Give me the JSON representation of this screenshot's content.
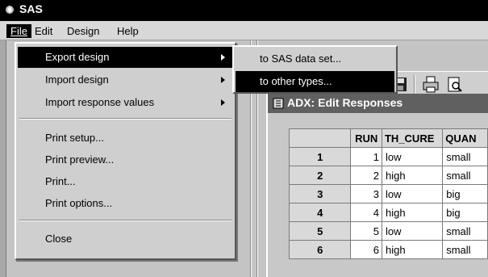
{
  "app": {
    "title": "SAS"
  },
  "menubar": {
    "items": [
      "File",
      "Edit",
      "Design",
      "Help"
    ]
  },
  "file_menu": {
    "export_design": "Export design",
    "import_design": "Import design",
    "import_response_values": "Import response values",
    "print_setup": "Print setup...",
    "print_preview": "Print preview...",
    "print": "Print...",
    "print_options": "Print options...",
    "close": "Close"
  },
  "export_submenu": {
    "to_sas_data_set": "to SAS data set...",
    "to_other_types": "to other types..."
  },
  "toolbar": {
    "icons": [
      "save-icon",
      "print-icon",
      "print-preview-icon"
    ]
  },
  "subwindow": {
    "title": "ADX: Edit Responses"
  },
  "grid": {
    "headers": [
      "RUN",
      "TH_CURE",
      "QUAN"
    ],
    "rows": [
      {
        "row": "1",
        "run": "1",
        "th_cure": "low",
        "quan": "small"
      },
      {
        "row": "2",
        "run": "2",
        "th_cure": "high",
        "quan": "small"
      },
      {
        "row": "3",
        "run": "3",
        "th_cure": "low",
        "quan": "big"
      },
      {
        "row": "4",
        "run": "4",
        "th_cure": "high",
        "quan": "big"
      },
      {
        "row": "5",
        "run": "5",
        "th_cure": "low",
        "quan": "small"
      },
      {
        "row": "6",
        "run": "6",
        "th_cure": "high",
        "quan": "small"
      }
    ]
  }
}
